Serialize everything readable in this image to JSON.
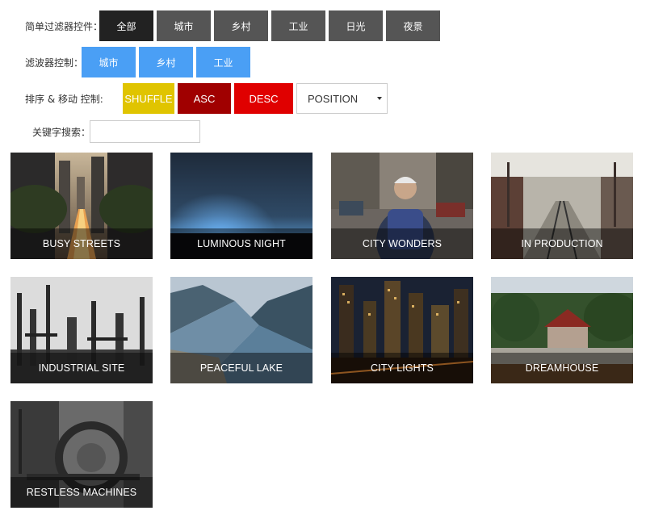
{
  "filters_simple": {
    "label": "简单过滤器控件：",
    "buttons": [
      "全部",
      "城市",
      "乡村",
      "工业",
      "日光",
      "夜景"
    ]
  },
  "filters_multi": {
    "label": "滤波器控制：",
    "buttons": [
      "城市",
      "乡村",
      "工业"
    ]
  },
  "sort": {
    "label": "排序 & 移动 控制:",
    "shuffle": "SHUFFLE",
    "asc": "ASC",
    "desc": "DESC",
    "select_value": "POSITION",
    "colors": {
      "shuffle": "#e0c400",
      "asc": "#a00000",
      "desc": "#e00000"
    }
  },
  "search": {
    "label": "关键字搜索：",
    "placeholder": ""
  },
  "gallery": {
    "items": [
      "BUSY STREETS",
      "LUMINOUS NIGHT",
      "CITY WONDERS",
      "IN PRODUCTION",
      "INDUSTRIAL SITE",
      "PEACEFUL LAKE",
      "CITY LIGHTS",
      "DREAMHOUSE",
      "RESTLESS MACHINES"
    ]
  }
}
